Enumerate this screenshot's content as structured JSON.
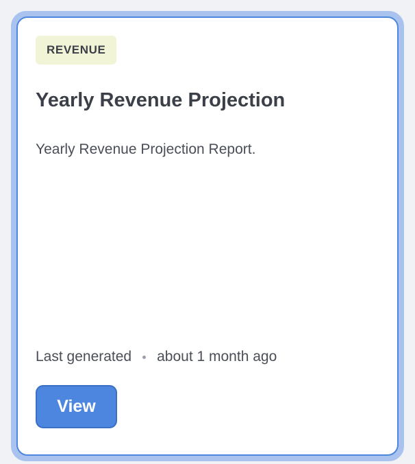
{
  "card": {
    "tag": "REVENUE",
    "title": "Yearly Revenue Projection",
    "description": "Yearly Revenue Projection Report.",
    "meta": {
      "label": "Last generated",
      "value": "about 1 month ago"
    },
    "view_button": "View"
  },
  "colors": {
    "accent": "#4c86de",
    "tag_background": "#f2f4d8",
    "page_background": "#f1f2f6",
    "focus_ring": "#a9c3ee"
  }
}
